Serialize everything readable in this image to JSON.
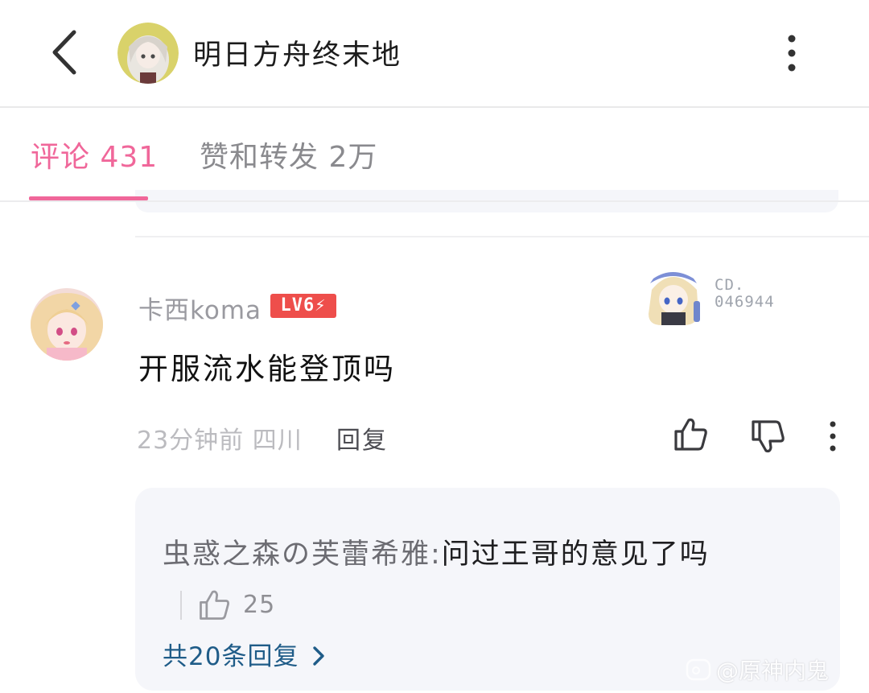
{
  "header": {
    "title": "明日方舟终末地"
  },
  "tabs": [
    {
      "label": "评论 431",
      "active": true
    },
    {
      "label": "赞和转发 2万",
      "active": false
    }
  ],
  "comment": {
    "username": "卡西koma",
    "level": "LV6",
    "decoration_text_line1": "CD.",
    "decoration_text_line2": "046944",
    "text": "开服流水能登顶吗",
    "time_location": "23分钟前 四川",
    "reply_label": "回复"
  },
  "replies": {
    "first_reply_name": "虫惑之森の芙蕾希雅:",
    "first_reply_text": "问过王哥的意见了吗",
    "first_reply_likes": "25",
    "more_label": "共20条回复"
  },
  "watermark": "@原神内鬼",
  "colors": {
    "accent": "#f0679a",
    "level_badge": "#ee4e4b",
    "link": "#1f5c88"
  }
}
